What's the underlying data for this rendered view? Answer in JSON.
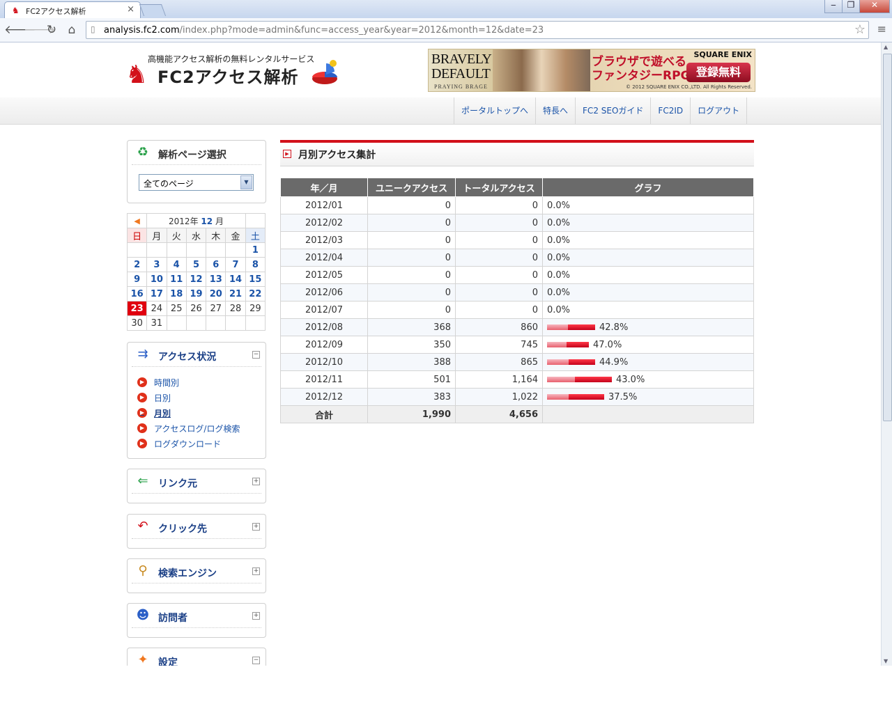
{
  "browser": {
    "tab_title": "FC2アクセス解析",
    "url_host": "analysis.fc2.com",
    "url_path": "/index.php?mode=admin&func=access_year&year=2012&month=12&date=23"
  },
  "header": {
    "tagline": "高機能アクセス解析の無料レンタルサービス",
    "logo_text": "FC2アクセス解析",
    "banner": {
      "title_line1": "BRAVELY",
      "title_line2": "DEFAULT",
      "subtitle": "PRAYING BRAGE",
      "copy_line1": "ブラウザで遊べる",
      "copy_line2": "ファンタジーRPG",
      "brand": "SQUARE ENIX",
      "cta": "登録無料",
      "copyright": "© 2012 SQUARE ENIX CO.,LTD. All Rights Reserved."
    }
  },
  "nav": {
    "items": [
      "ポータルトップへ",
      "特長へ",
      "FC2 SEOガイド",
      "FC2ID",
      "ログアウト"
    ]
  },
  "sidebar": {
    "page_select": {
      "title": "解析ページ選択",
      "value": "全てのページ"
    },
    "calendar": {
      "year": "2012",
      "year_suffix": "年",
      "month": "12",
      "month_suffix": "月",
      "weekdays": [
        "日",
        "月",
        "火",
        "水",
        "木",
        "金",
        "土"
      ],
      "weeks": [
        [
          "",
          "",
          "",
          "",
          "",
          "",
          "1"
        ],
        [
          "2",
          "3",
          "4",
          "5",
          "6",
          "7",
          "8"
        ],
        [
          "9",
          "10",
          "11",
          "12",
          "13",
          "14",
          "15"
        ],
        [
          "16",
          "17",
          "18",
          "19",
          "20",
          "21",
          "22"
        ],
        [
          "23",
          "24",
          "25",
          "26",
          "27",
          "28",
          "29"
        ],
        [
          "30",
          "31",
          "",
          "",
          "",
          "",
          ""
        ]
      ],
      "today": "23",
      "linked_through": 22
    },
    "access": {
      "title": "アクセス状況",
      "toggle": "−",
      "items": [
        "時間別",
        "日別",
        "月別",
        "アクセスログ/ログ検索",
        "ログダウンロード"
      ],
      "current": "月別"
    },
    "sections": [
      {
        "title": "リンク元",
        "toggle": "+",
        "icon": "link-source-icon"
      },
      {
        "title": "クリック先",
        "toggle": "+",
        "icon": "click-target-icon"
      },
      {
        "title": "検索エンジン",
        "toggle": "+",
        "icon": "magnifier-icon"
      },
      {
        "title": "訪問者",
        "toggle": "+",
        "icon": "visitor-icon"
      },
      {
        "title": "設定",
        "toggle": "−",
        "icon": "settings-icon"
      }
    ]
  },
  "main": {
    "title": "月別アクセス集計",
    "table": {
      "headers": [
        "年／月",
        "ユニークアクセス",
        "トータルアクセス",
        "グラフ"
      ],
      "rows": [
        {
          "month": "2012/01",
          "unique": "0",
          "total": "0",
          "pct": "0.0%",
          "total_num": 0,
          "unique_num": 0
        },
        {
          "month": "2012/02",
          "unique": "0",
          "total": "0",
          "pct": "0.0%",
          "total_num": 0,
          "unique_num": 0
        },
        {
          "month": "2012/03",
          "unique": "0",
          "total": "0",
          "pct": "0.0%",
          "total_num": 0,
          "unique_num": 0
        },
        {
          "month": "2012/04",
          "unique": "0",
          "total": "0",
          "pct": "0.0%",
          "total_num": 0,
          "unique_num": 0
        },
        {
          "month": "2012/05",
          "unique": "0",
          "total": "0",
          "pct": "0.0%",
          "total_num": 0,
          "unique_num": 0
        },
        {
          "month": "2012/06",
          "unique": "0",
          "total": "0",
          "pct": "0.0%",
          "total_num": 0,
          "unique_num": 0
        },
        {
          "month": "2012/07",
          "unique": "0",
          "total": "0",
          "pct": "0.0%",
          "total_num": 0,
          "unique_num": 0
        },
        {
          "month": "2012/08",
          "unique": "368",
          "total": "860",
          "pct": "42.8%",
          "total_num": 860,
          "unique_num": 368
        },
        {
          "month": "2012/09",
          "unique": "350",
          "total": "745",
          "pct": "47.0%",
          "total_num": 745,
          "unique_num": 350
        },
        {
          "month": "2012/10",
          "unique": "388",
          "total": "865",
          "pct": "44.9%",
          "total_num": 865,
          "unique_num": 388
        },
        {
          "month": "2012/11",
          "unique": "501",
          "total": "1,164",
          "pct": "43.0%",
          "total_num": 1164,
          "unique_num": 501
        },
        {
          "month": "2012/12",
          "unique": "383",
          "total": "1,022",
          "pct": "37.5%",
          "total_num": 1022,
          "unique_num": 383
        }
      ],
      "total_label": "合計",
      "total_unique": "1,990",
      "total_total": "4,656"
    }
  },
  "colors": {
    "accent_red": "#d2101a",
    "link_blue": "#1a53a8",
    "table_header": "#6a6a6a"
  }
}
